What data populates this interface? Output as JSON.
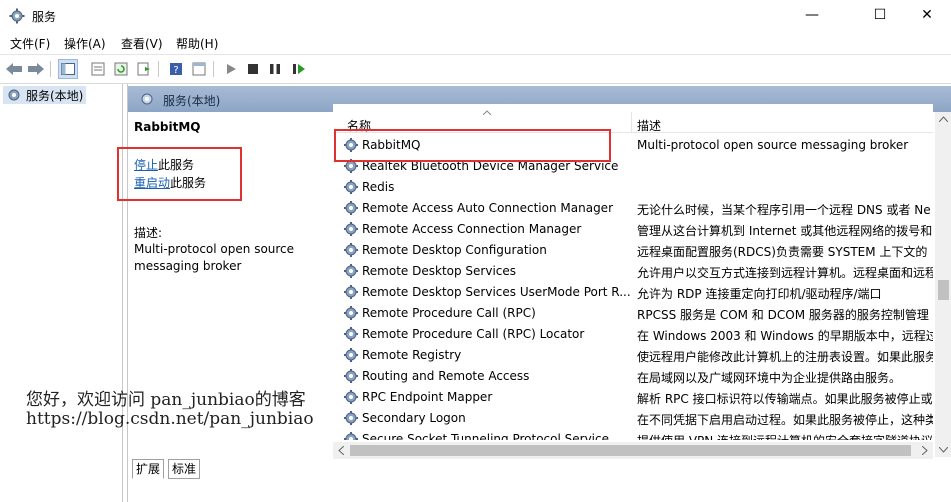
{
  "window": {
    "title": "服务",
    "minimize": "—",
    "maximize": "☐",
    "close": "✕"
  },
  "menu": [
    "文件(F)",
    "操作(A)",
    "查看(V)",
    "帮助(H)"
  ],
  "tree": {
    "root_label": "服务(本地)"
  },
  "pane": {
    "header_title": "服务(本地)",
    "selected_name": "RabbitMQ",
    "stop_link": "停止",
    "stop_suffix": "此服务",
    "restart_link": "重启动",
    "restart_suffix": "此服务",
    "desc_label": "描述:",
    "desc_line1": "Multi-protocol open source",
    "desc_line2": "messaging broker"
  },
  "list": {
    "col_name": "名称",
    "col_desc": "描述",
    "rows": [
      {
        "name": "RabbitMQ",
        "desc": "Multi-protocol open source messaging broker"
      },
      {
        "name": "Realtek Bluetooth Device Manager Service",
        "desc": ""
      },
      {
        "name": "Redis",
        "desc": ""
      },
      {
        "name": "Remote Access Auto Connection Manager",
        "desc": "无论什么时候，当某个程序引用一个远程 DNS 或者 Ne"
      },
      {
        "name": "Remote Access Connection Manager",
        "desc": "管理从这台计算机到 Internet 或其他远程网络的拨号和"
      },
      {
        "name": "Remote Desktop Configuration",
        "desc": "远程桌面配置服务(RDCS)负责需要 SYSTEM 上下文的"
      },
      {
        "name": "Remote Desktop Services",
        "desc": "允许用户以交互方式连接到远程计算机。远程桌面和远程"
      },
      {
        "name": "Remote Desktop Services UserMode Port R...",
        "desc": "允许为 RDP 连接重定向打印机/驱动程序/端口"
      },
      {
        "name": "Remote Procedure Call (RPC)",
        "desc": "RPCSS 服务是 COM 和 DCOM 服务器的服务控制管理"
      },
      {
        "name": "Remote Procedure Call (RPC) Locator",
        "desc": "在 Windows 2003 和 Windows 的早期版本中，远程过"
      },
      {
        "name": "Remote Registry",
        "desc": "使远程用户能修改此计算机上的注册表设置。如果此服务"
      },
      {
        "name": "Routing and Remote Access",
        "desc": "在局域网以及广域网环境中为企业提供路由服务。"
      },
      {
        "name": "RPC Endpoint Mapper",
        "desc": "解析 RPC 接口标识符以传输端点。如果此服务被停止或"
      },
      {
        "name": "Secondary Logon",
        "desc": "在不同凭据下启用启动过程。如果此服务被停止，这种类"
      },
      {
        "name": "Secure Socket Tunneling Protocol Service",
        "desc": "提供使用 VPN 连接到远程计算机的安全套接字隧道协议"
      }
    ]
  },
  "tabs": [
    "扩展",
    "标准"
  ],
  "watermark": {
    "line1": "您好，欢迎访问 pan_junbiao的博客",
    "line2": "https://blog.csdn.net/pan_junbiao"
  },
  "colors": {
    "highlight_box": "#e03030",
    "link": "#1a5fb4",
    "header": "#8da5c6"
  }
}
